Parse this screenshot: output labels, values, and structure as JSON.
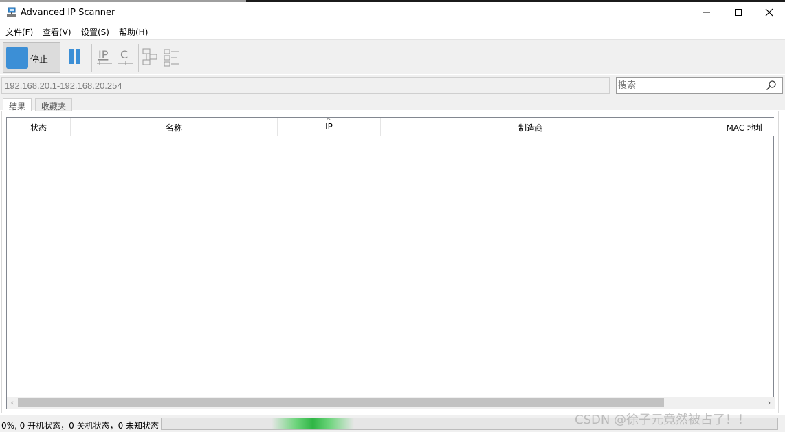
{
  "window": {
    "title": "Advanced IP Scanner",
    "controls": [
      "minimize",
      "maximize",
      "close"
    ]
  },
  "menu": {
    "items": [
      "文件(F)",
      "查看(V)",
      "设置(S)",
      "帮助(H)"
    ]
  },
  "toolbar": {
    "stop_label": "停止",
    "accent_color": "#3c8fd6",
    "icons": [
      "pause-icon",
      "ip-icon",
      "c-icon",
      "network-icon",
      "list-icon"
    ]
  },
  "address_bar": {
    "range_value": "192.168.20.1-192.168.20.254",
    "search_placeholder": "搜索"
  },
  "tabs": [
    {
      "label": "结果",
      "active": true
    },
    {
      "label": "收藏夹",
      "active": false
    }
  ],
  "table": {
    "columns": [
      "状态",
      "名称",
      "IP",
      "制造商",
      "MAC 地址"
    ],
    "sorted_column": "IP",
    "rows": []
  },
  "status": {
    "text": "0%, 0 开机状态，0 关机状态，0 未知状态",
    "progress_color": "#2fb545"
  },
  "watermark": "CSDN @徐子元竟然被占了！！"
}
